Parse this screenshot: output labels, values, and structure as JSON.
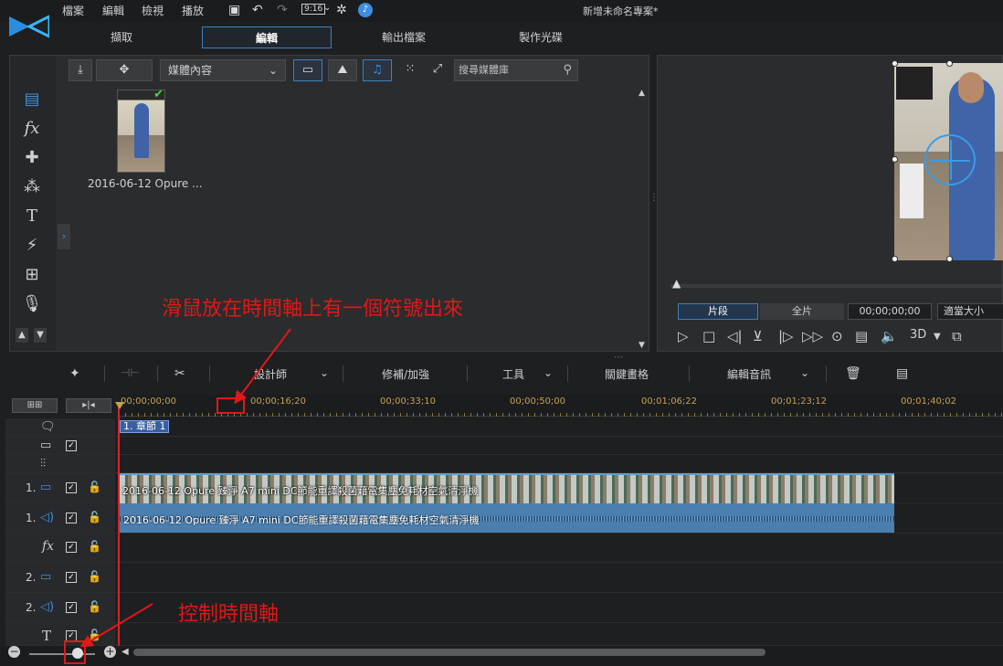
{
  "menu": [
    "檔案",
    "編輯",
    "檢視",
    "播放"
  ],
  "toolbar_clock": "9:16",
  "window_title": "新增未命名專案*",
  "mode_tabs": [
    {
      "label": "擷取",
      "active": false
    },
    {
      "label": "編輯",
      "active": true
    },
    {
      "label": "輸出檔案",
      "active": false
    },
    {
      "label": "製作光碟",
      "active": false
    }
  ],
  "library": {
    "dropdown": "媒體內容",
    "search_placeholder": "搜尋媒體庫",
    "thumbnail_label": "2016-06-12 Opure ..."
  },
  "preview": {
    "clip_mode": "片段",
    "movie_mode": "全片",
    "timecode": "00;00;00;00",
    "zoom": "適當大小",
    "three_d": "3D"
  },
  "timeline_toolbar": {
    "designer": "設計師",
    "fix": "修補/加強",
    "tools": "工具",
    "keyframe": "關鍵畫格",
    "audio_edit": "編輯音訊"
  },
  "ruler": [
    "00;00;00;00",
    "00;00;16;20",
    "00;00;33;10",
    "00;00;50;00",
    "00;01;06;22",
    "00;01;23;12",
    "00;01;40;02"
  ],
  "chapter": "1. 章節 1",
  "tracks": {
    "video1": "1.",
    "audio1": "1.",
    "video2": "2.",
    "audio2": "2."
  },
  "clip_name": "2016-06-12 Opure 臻淨 A7 mini DC節能重譯殺菌藉電集塵免耗材空氣清淨機",
  "annotations": {
    "mouse_hint": "滑鼠放在時間軸上有一個符號出來",
    "control_hint": "控制時間軸"
  },
  "colors": {
    "accent": "#3d8fe0",
    "annotation": "#e01818",
    "playhead": "#dd2222"
  }
}
